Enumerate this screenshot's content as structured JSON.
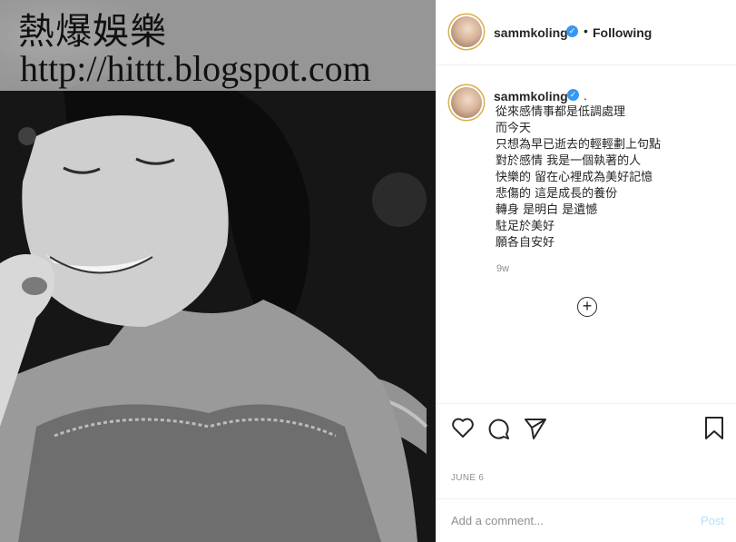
{
  "watermark": {
    "title": "熱爆娛樂",
    "url": "http://hittt.blogspot.com"
  },
  "header": {
    "username": "sammkoling",
    "separator": "•",
    "follow_status": "Following",
    "more_icon": "more-horizontal-icon"
  },
  "caption": {
    "username": "sammkoling",
    "trailing": ".",
    "lines": [
      "從來感情事都是低調處理",
      "而今天",
      "只想為早已逝去的輕輕劃上句點",
      "對於感情 我是一個執著的人",
      "快樂的 留在心裡成為美好記憶",
      "悲傷的 這是成長的養份",
      "轉身 是明白 是遺憾",
      "駐足於美好",
      "願各自安好"
    ],
    "age": "9w"
  },
  "load_more_icon": "plus-circle-icon",
  "actions": {
    "like_icon": "heart-icon",
    "comment_icon": "comment-icon",
    "share_icon": "paper-plane-icon",
    "save_icon": "bookmark-icon"
  },
  "date": "JUNE 6",
  "comment": {
    "placeholder": "Add a comment...",
    "post_label": "Post"
  },
  "colors": {
    "verified": "#3897f0",
    "post_disabled": "#b2dffc",
    "meta_gray": "#8e8e8e",
    "text": "#262626"
  }
}
